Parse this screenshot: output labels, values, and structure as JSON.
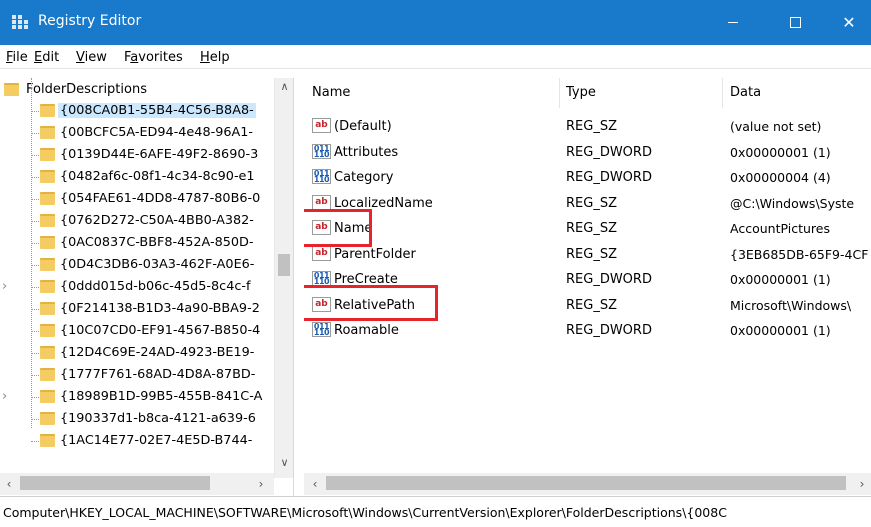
{
  "window": {
    "title": "Registry Editor",
    "minimize_glyph": "—",
    "close_glyph": "✕"
  },
  "menu": [
    "File",
    "Edit",
    "View",
    "Favorites",
    "Help"
  ],
  "menu_shortcuts": [
    "F",
    "E",
    "V",
    "a",
    "H"
  ],
  "tree": {
    "root": "FolderDescriptions",
    "items": [
      "{008CA0B1-55B4-4C56-B8A8-",
      "{00BCFC5A-ED94-4e48-96A1-",
      "{0139D44E-6AFE-49F2-8690-3",
      "{0482af6c-08f1-4c34-8c90-e1",
      "{054FAE61-4DD8-4787-80B6-0",
      "{0762D272-C50A-4BB0-A382-",
      "{0AC0837C-BBF8-452A-850D-",
      "{0D4C3DB6-03A3-462F-A0E6-",
      "{0ddd015d-b06c-45d5-8c4c-f",
      "{0F214138-B1D3-4a90-BBA9-2",
      "{10C07CD0-EF91-4567-B850-4",
      "{12D4C69E-24AD-4923-BE19-",
      "{1777F761-68AD-4D8A-87BD-",
      "{18989B1D-99B5-455B-841C-A",
      "{190337d1-b8ca-4121-a639-6",
      "{1AC14E77-02E7-4E5D-B744-"
    ],
    "selected_index": 0,
    "expandable_indices": [
      8,
      13
    ]
  },
  "columns": {
    "name": "Name",
    "type": "Type",
    "data": "Data"
  },
  "values": [
    {
      "icon": "string-value-icon",
      "glyph": "ab",
      "name": "(Default)",
      "type": "REG_SZ",
      "data": "(value not set)"
    },
    {
      "icon": "binary-value-icon",
      "glyph": "011\n110",
      "name": "Attributes",
      "type": "REG_DWORD",
      "data": "0x00000001 (1)"
    },
    {
      "icon": "binary-value-icon",
      "glyph": "011\n110",
      "name": "Category",
      "type": "REG_DWORD",
      "data": "0x00000004 (4)"
    },
    {
      "icon": "string-value-icon",
      "glyph": "ab",
      "name": "LocalizedName",
      "type": "REG_SZ",
      "data": "@C:\\Windows\\Syste"
    },
    {
      "icon": "string-value-icon",
      "glyph": "ab",
      "name": "Name",
      "type": "REG_SZ",
      "data": "AccountPictures"
    },
    {
      "icon": "string-value-icon",
      "glyph": "ab",
      "name": "ParentFolder",
      "type": "REG_SZ",
      "data": "{3EB685DB-65F9-4CF"
    },
    {
      "icon": "binary-value-icon",
      "glyph": "011\n110",
      "name": "PreCreate",
      "type": "REG_DWORD",
      "data": "0x00000001 (1)"
    },
    {
      "icon": "string-value-icon",
      "glyph": "ab",
      "name": "RelativePath",
      "type": "REG_SZ",
      "data": "Microsoft\\Windows\\"
    },
    {
      "icon": "binary-value-icon",
      "glyph": "011\n110",
      "name": "Roamable",
      "type": "REG_DWORD",
      "data": "0x00000001 (1)"
    }
  ],
  "highlighted_values": [
    "Name",
    "RelativePath"
  ],
  "highlight_color": "#e8232c",
  "accent_color": "#1979ca",
  "status_path": "Computer\\HKEY_LOCAL_MACHINE\\SOFTWARE\\Microsoft\\Windows\\CurrentVersion\\Explorer\\FolderDescriptions\\{008C"
}
